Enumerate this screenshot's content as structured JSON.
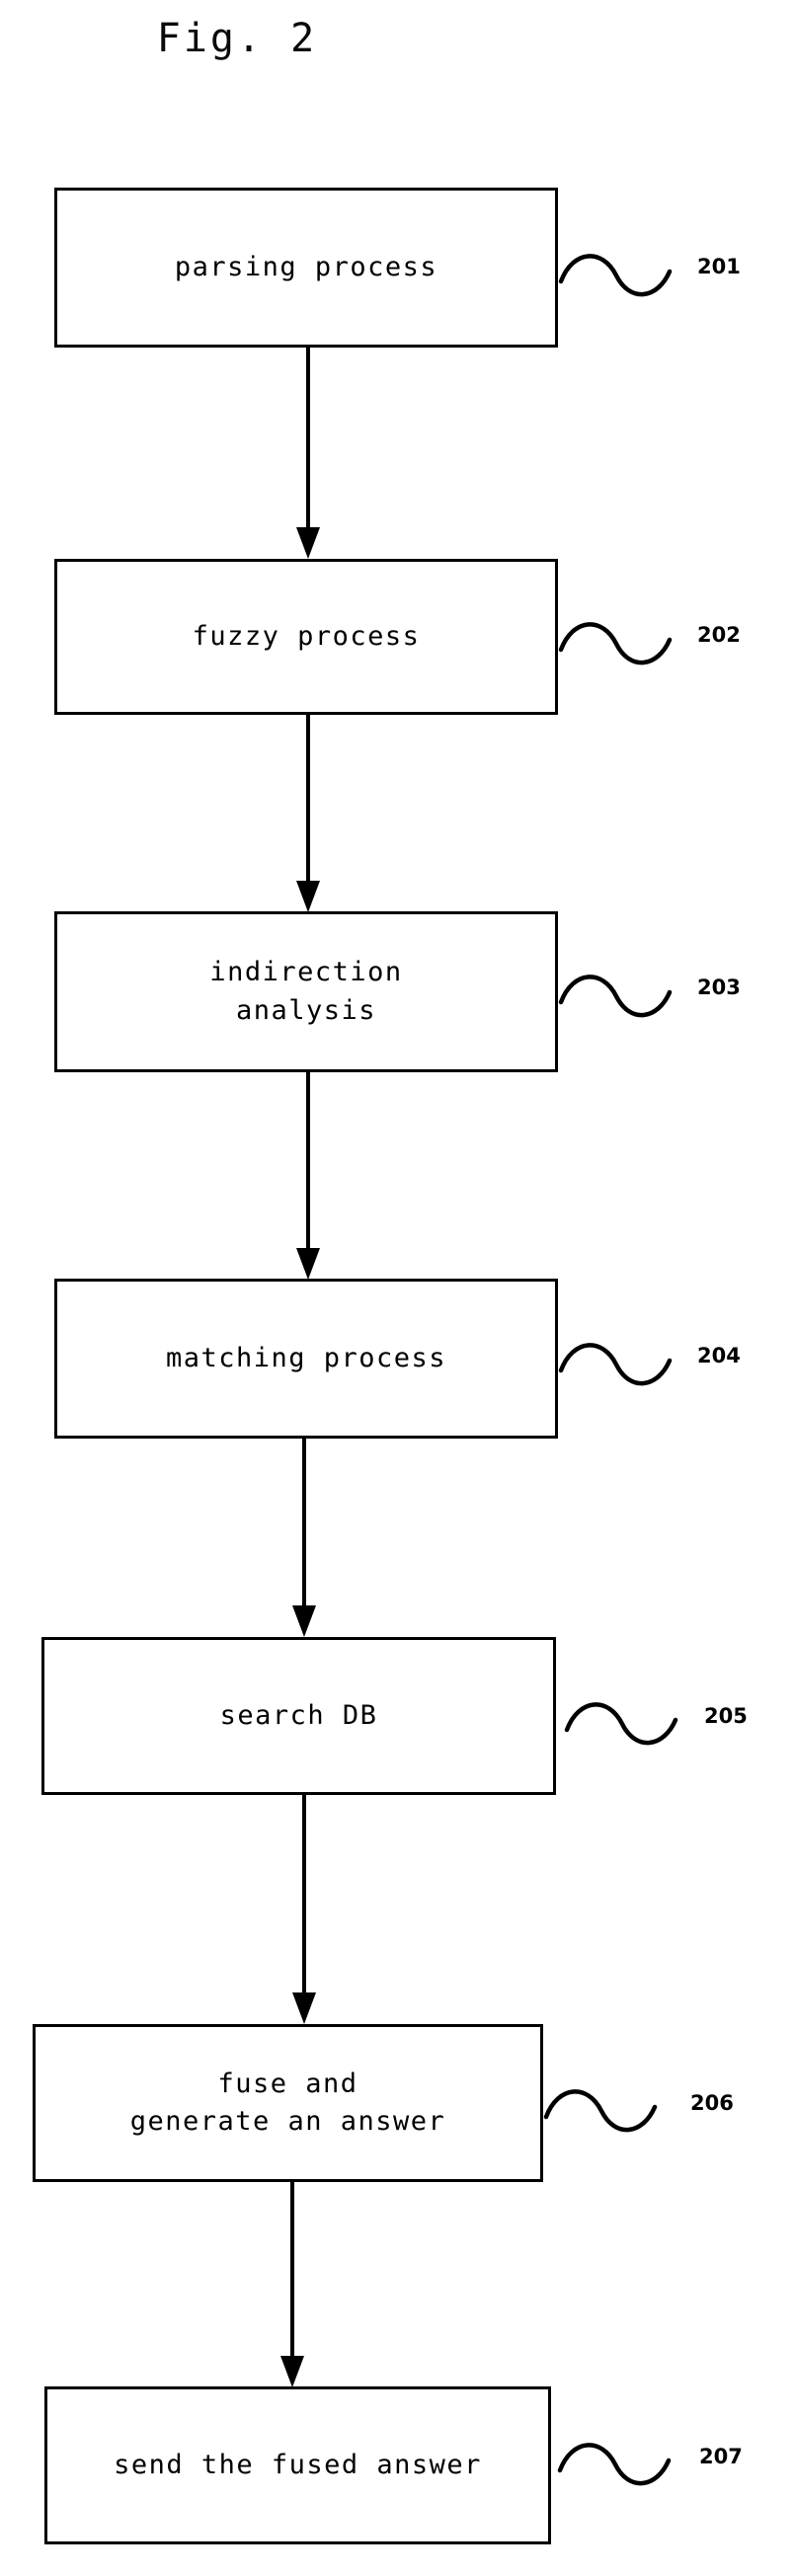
{
  "figure": {
    "title": "Fig. 2",
    "domain_note": "patent flowchart"
  },
  "steps": [
    {
      "id": "201",
      "label": "parsing process",
      "ref_number": "201"
    },
    {
      "id": "202",
      "label": "fuzzy process",
      "ref_number": "202"
    },
    {
      "id": "203",
      "label": "indirection\nanalysis",
      "ref_number": "203"
    },
    {
      "id": "204",
      "label": "matching process",
      "ref_number": "204"
    },
    {
      "id": "205",
      "label": "search DB",
      "ref_number": "205"
    },
    {
      "id": "206",
      "label": "fuse and\ngenerate an answer",
      "ref_number": "206"
    },
    {
      "id": "207",
      "label": "send the fused answer",
      "ref_number": "207"
    }
  ],
  "colors": {
    "ink": "#000000",
    "paper": "#ffffff"
  }
}
